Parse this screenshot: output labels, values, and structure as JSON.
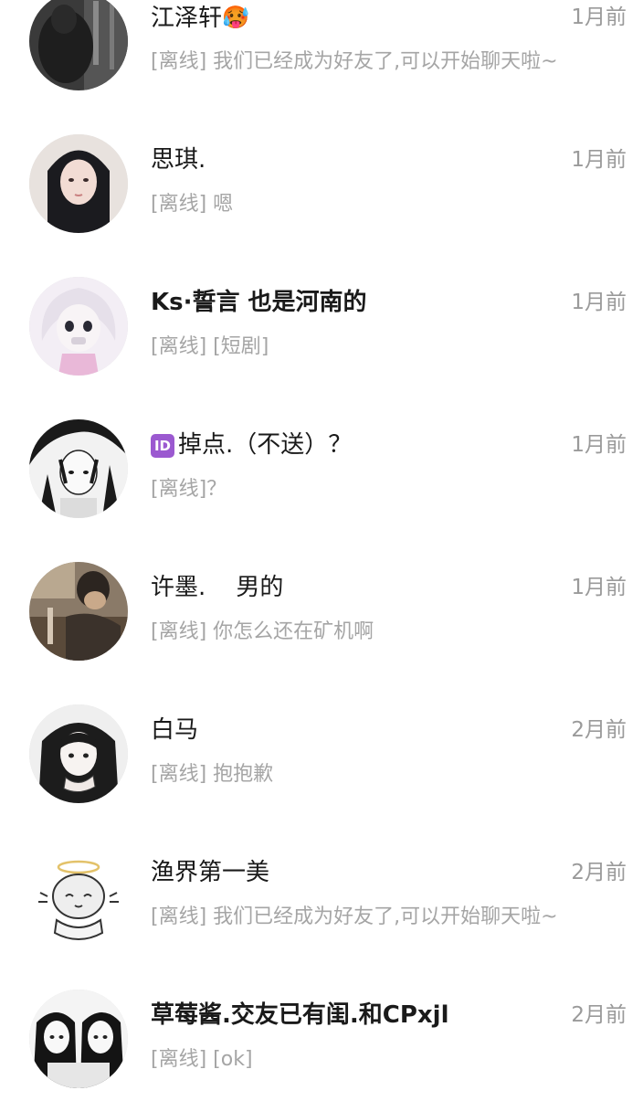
{
  "conversations": [
    {
      "name": "江泽轩",
      "name_suffix_icon": "hot-face-emoji",
      "name_suffix_glyph": "🥵",
      "time": "1月前",
      "preview": "[离线] 我们已经成为好友了,可以开始聊天啦~",
      "avatar_icon": "dark-photo-avatar"
    },
    {
      "name": "思琪.",
      "time": "1月前",
      "preview": "[离线] 嗯",
      "avatar_icon": "girl-portrait-avatar"
    },
    {
      "name": "Ks·誓言 也是河南的",
      "time": "1月前",
      "preview": "[离线] [短剧]",
      "avatar_icon": "anime-white-hair-avatar"
    },
    {
      "name_prefix_badge": "ID",
      "name": "掉点.（不送）？",
      "time": "1月前",
      "preview": "[离线]？",
      "avatar_icon": "anime-sketch-avatar"
    },
    {
      "name": "许墨.    男的",
      "time": "1月前",
      "preview": "[离线] 你怎么还在矿机啊",
      "avatar_icon": "photo-person-avatar"
    },
    {
      "name": "白马",
      "time": "2月前",
      "preview": "[离线] 抱抱歉",
      "avatar_icon": "anime-girl-avatar"
    },
    {
      "name": "渔界第一美",
      "time": "2月前",
      "preview": "[离线] 我们已经成为好友了,可以开始聊天啦~",
      "avatar_icon": "doodle-character-avatar"
    },
    {
      "name": "草莓酱.交友已有闺.和CPxjl",
      "time": "2月前",
      "preview": "[离线] [ok]",
      "avatar_icon": "anime-duo-avatar"
    }
  ],
  "colors": {
    "name": "#1a1a1a",
    "time": "#9a9a9a",
    "preview": "#a5a5a5",
    "id_badge": "#9b59d0"
  }
}
